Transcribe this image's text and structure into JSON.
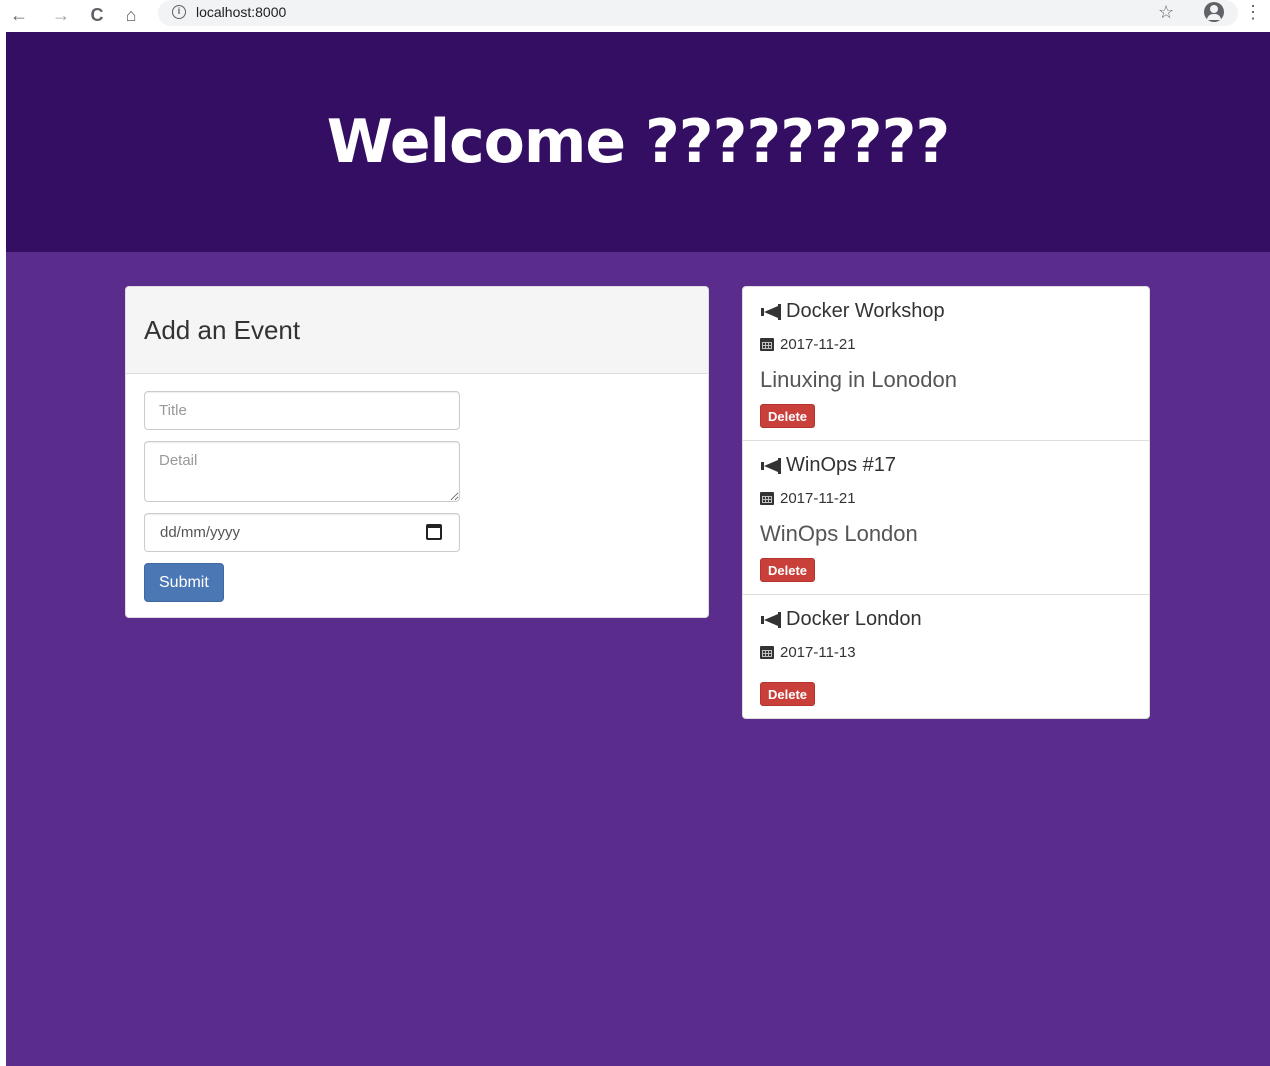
{
  "browser": {
    "url": "localhost:8000",
    "back_icon": "←",
    "forward_icon": "→",
    "reload_icon": "C",
    "home_icon": "⌂",
    "info_icon": "i",
    "star_icon": "☆",
    "menu_icon": "⋮"
  },
  "header": {
    "title": "Welcome ?????????"
  },
  "form": {
    "heading": "Add an Event",
    "title_placeholder": "Title",
    "detail_placeholder": "Detail",
    "date_placeholder": "dd/mm/yyyy",
    "submit_label": "Submit"
  },
  "events": [
    {
      "title": "Docker Workshop",
      "date": "2017-11-21",
      "detail": "Linuxing in Lonodon",
      "delete_label": "Delete"
    },
    {
      "title": "WinOps #17",
      "date": "2017-11-21",
      "detail": "WinOps London",
      "delete_label": "Delete"
    },
    {
      "title": "Docker London",
      "date": "2017-11-13",
      "detail": "",
      "delete_label": "Delete"
    }
  ],
  "colors": {
    "header_bg": "#340e63",
    "page_bg": "#5a2d8c",
    "submit_bg": "#4b78b5",
    "delete_bg": "#c9403a"
  }
}
